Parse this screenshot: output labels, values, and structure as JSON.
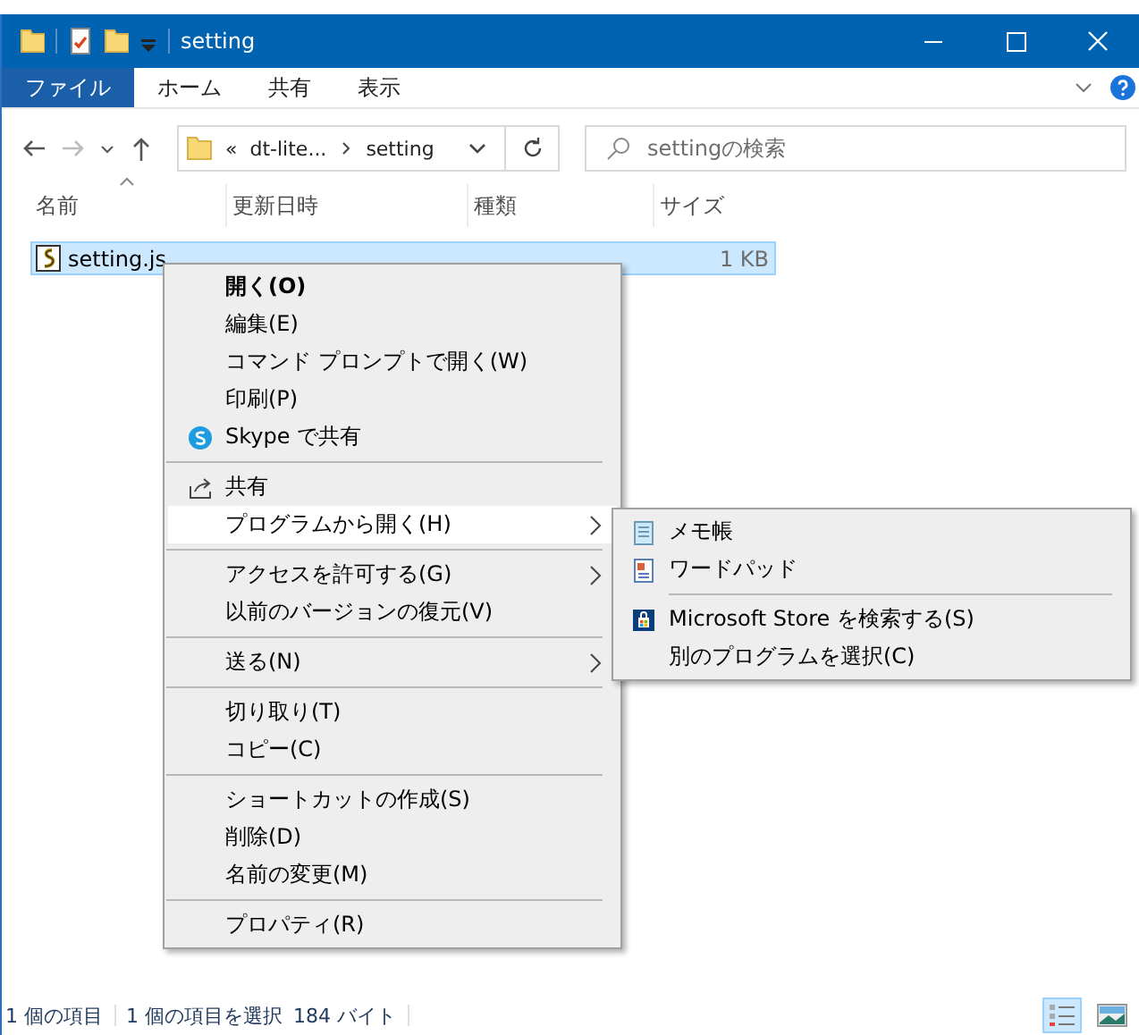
{
  "window": {
    "title": "setting"
  },
  "ribbon_tabs": [
    {
      "label": "ファイル",
      "selected": true
    },
    {
      "label": "ホーム",
      "selected": false
    },
    {
      "label": "共有",
      "selected": false
    },
    {
      "label": "表示",
      "selected": false
    }
  ],
  "address": {
    "overflow": "«",
    "segments": [
      "dt-lite...",
      "setting"
    ]
  },
  "search": {
    "placeholder": "settingの検索"
  },
  "columns": [
    "名前",
    "更新日時",
    "種類",
    "サイズ"
  ],
  "files": [
    {
      "name": "setting.js",
      "size": "1 KB",
      "selected": true
    }
  ],
  "context_menu": [
    {
      "kind": "item",
      "label": "開く(O)",
      "default": true,
      "selected": false
    },
    {
      "kind": "item",
      "label": "編集(E)",
      "default": false,
      "selected": false
    },
    {
      "kind": "item",
      "label": "コマンド プロンプトで開く(W)",
      "default": false,
      "selected": false
    },
    {
      "kind": "item",
      "label": "印刷(P)",
      "default": false,
      "selected": false
    },
    {
      "kind": "item",
      "label": "Skype で共有",
      "default": false,
      "selected": false
    },
    {
      "kind": "separator"
    },
    {
      "kind": "item",
      "label": "共有",
      "default": false,
      "selected": false
    },
    {
      "kind": "submenu",
      "label": "プログラムから開く(H)",
      "default": false,
      "selected": true
    },
    {
      "kind": "separator"
    },
    {
      "kind": "submenu",
      "label": "アクセスを許可する(G)",
      "default": false,
      "selected": false
    },
    {
      "kind": "item",
      "label": "以前のバージョンの復元(V)",
      "default": false,
      "selected": false
    },
    {
      "kind": "separator"
    },
    {
      "kind": "submenu",
      "label": "送る(N)",
      "default": false,
      "selected": false
    },
    {
      "kind": "separator"
    },
    {
      "kind": "item",
      "label": "切り取り(T)",
      "default": false,
      "selected": false
    },
    {
      "kind": "item",
      "label": "コピー(C)",
      "default": false,
      "selected": false
    },
    {
      "kind": "separator"
    },
    {
      "kind": "item",
      "label": "ショートカットの作成(S)",
      "default": false,
      "selected": false
    },
    {
      "kind": "item",
      "label": "削除(D)",
      "default": false,
      "selected": false
    },
    {
      "kind": "item",
      "label": "名前の変更(M)",
      "default": false,
      "selected": false
    },
    {
      "kind": "separator"
    },
    {
      "kind": "item",
      "label": "プロパティ(R)",
      "default": false,
      "selected": false
    }
  ],
  "submenu": [
    {
      "kind": "item",
      "label": "メモ帳"
    },
    {
      "kind": "item",
      "label": "ワードパッド"
    },
    {
      "kind": "separator"
    },
    {
      "kind": "item",
      "label": "Microsoft Store を検索する(S)"
    },
    {
      "kind": "item",
      "label": "別のプログラムを選択(C)"
    }
  ],
  "status_bar": {
    "count": "1 個の項目",
    "selection": "1 個の項目を選択",
    "size": "184 バイト"
  },
  "views": [
    {
      "selected": true
    },
    {
      "selected": false
    }
  ]
}
